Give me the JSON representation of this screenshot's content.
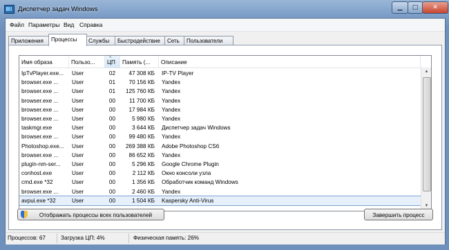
{
  "window": {
    "title": "Диспетчер задач Windows"
  },
  "menu": [
    "Файл",
    "Параметры",
    "Вид",
    "Справка"
  ],
  "tabs": [
    "Приложения",
    "Процессы",
    "Службы",
    "Быстродействие",
    "Сеть",
    "Пользователи"
  ],
  "active_tab": "Процессы",
  "columns": [
    "Имя образа",
    "Пользо...",
    "ЦП",
    "Память (...",
    "Описание"
  ],
  "sorted_column": "ЦП",
  "rows": [
    {
      "name": "IpTvPlayer.exe...",
      "user": "User",
      "cpu": "02",
      "mem": "47 308 КБ",
      "desc": "IP-TV Player"
    },
    {
      "name": "browser.exe ...",
      "user": "User",
      "cpu": "01",
      "mem": "70 156 КБ",
      "desc": "Yandex"
    },
    {
      "name": "browser.exe ...",
      "user": "User",
      "cpu": "01",
      "mem": "125 760 КБ",
      "desc": "Yandex"
    },
    {
      "name": "browser.exe ...",
      "user": "User",
      "cpu": "00",
      "mem": "11 700 КБ",
      "desc": "Yandex"
    },
    {
      "name": "browser.exe ...",
      "user": "User",
      "cpu": "00",
      "mem": "17 984 КБ",
      "desc": "Yandex"
    },
    {
      "name": "browser.exe ...",
      "user": "User",
      "cpu": "00",
      "mem": "5 980 КБ",
      "desc": "Yandex"
    },
    {
      "name": "taskmgr.exe",
      "user": "User",
      "cpu": "00",
      "mem": "3 644 КБ",
      "desc": "Диспетчер задач Windows"
    },
    {
      "name": "browser.exe ...",
      "user": "User",
      "cpu": "00",
      "mem": "99 480 КБ",
      "desc": "Yandex"
    },
    {
      "name": "Photoshop.exe...",
      "user": "User",
      "cpu": "00",
      "mem": "269 388 КБ",
      "desc": "Adobe Photoshop CS6"
    },
    {
      "name": "browser.exe ...",
      "user": "User",
      "cpu": "00",
      "mem": "86 652 КБ",
      "desc": "Yandex"
    },
    {
      "name": "plugin-nm-ser...",
      "user": "User",
      "cpu": "00",
      "mem": "5 296 КБ",
      "desc": "Google Chrome Plugin"
    },
    {
      "name": "conhost.exe",
      "user": "User",
      "cpu": "00",
      "mem": "2 112 КБ",
      "desc": "Окно консоли узла"
    },
    {
      "name": "cmd.exe *32",
      "user": "User",
      "cpu": "00",
      "mem": "1 356 КБ",
      "desc": "Обработчик команд Windows"
    },
    {
      "name": "browser.exe ...",
      "user": "User",
      "cpu": "00",
      "mem": "2 460 КБ",
      "desc": "Yandex"
    },
    {
      "name": "avpui.exe *32",
      "user": "User",
      "cpu": "00",
      "mem": "1 504 КБ",
      "desc": "Kaspersky Anti-Virus",
      "selected": true
    }
  ],
  "buttons": {
    "show_all": "Отображать процессы всех пользователей",
    "end_process": "Завершить процесс"
  },
  "status": {
    "processes": "Процессов: 67",
    "cpu": "Загрузка ЦП: 4%",
    "memory": "Физическая память: 26%"
  }
}
